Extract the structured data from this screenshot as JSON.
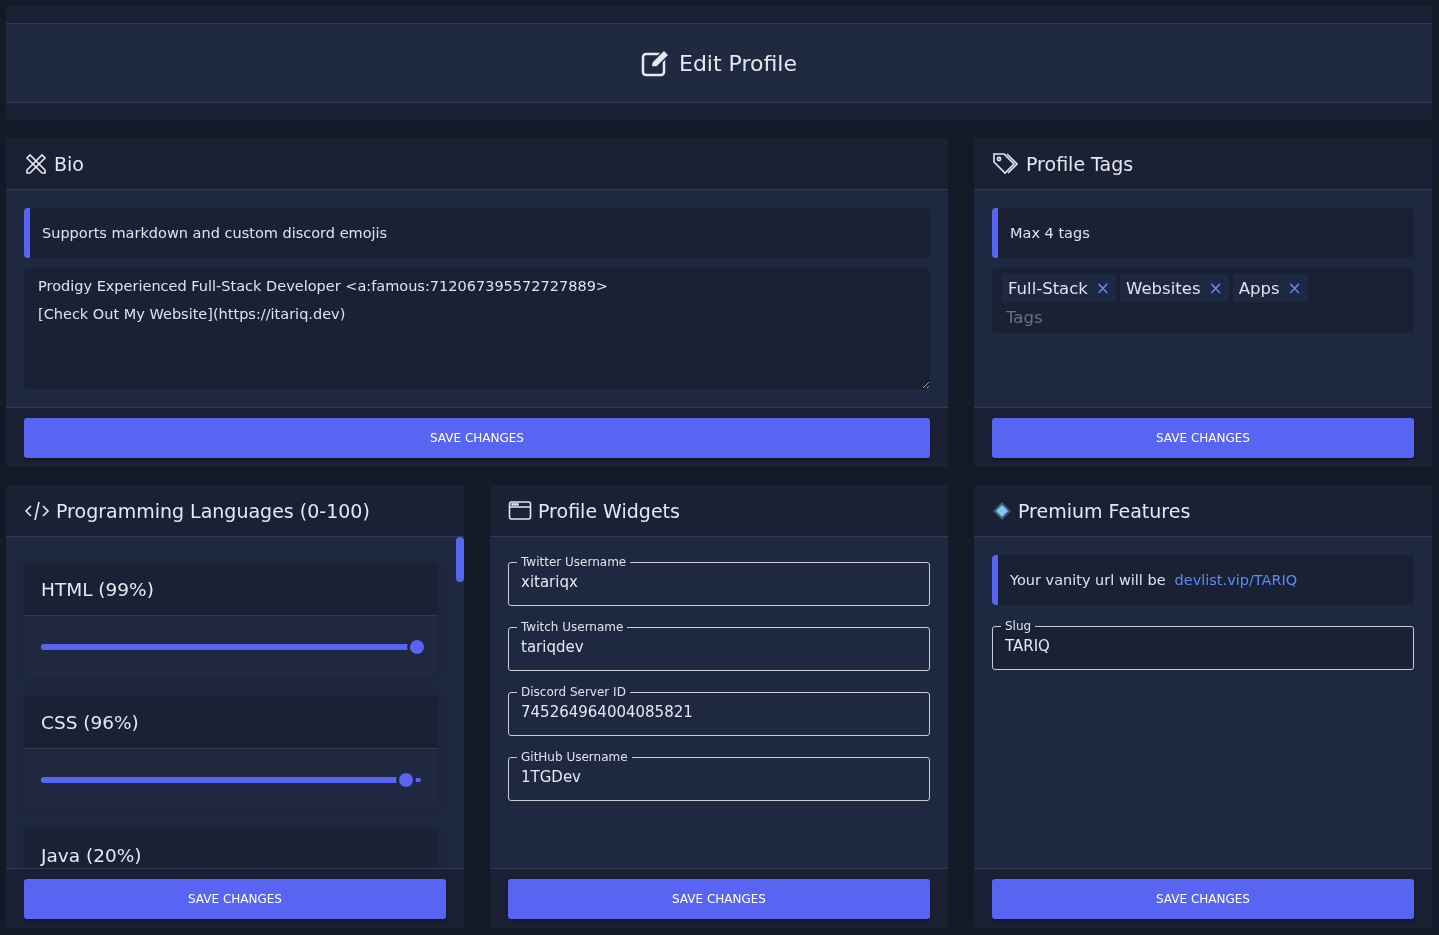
{
  "header": {
    "title": "Edit Profile"
  },
  "bio": {
    "title": "Bio",
    "note": "Supports markdown and custom discord emojis",
    "value": "Prodigy Experienced Full-Stack Developer <a:famous:712067395572727889>\n[Check Out My Website](https://itariq.dev)",
    "save_button": "SAVE CHANGES"
  },
  "profile_tags": {
    "title": "Profile Tags",
    "note": "Max 4 tags",
    "tags": [
      {
        "label": "Full-Stack",
        "remove": "×"
      },
      {
        "label": "Websites",
        "remove": "×"
      },
      {
        "label": "Apps",
        "remove": "×"
      }
    ],
    "placeholder": "Tags",
    "save_button": "SAVE CHANGES"
  },
  "programming_languages": {
    "title": "Programming Languages (0-100)",
    "languages": [
      {
        "label": "HTML (99%)",
        "level": 0.99
      },
      {
        "label": "CSS (96%)",
        "level": 0.96
      },
      {
        "label": "Java (20%)"
      }
    ],
    "save_button": "SAVE CHANGES"
  },
  "profile_widgets": {
    "title": "Profile Widgets",
    "fields": [
      {
        "label": "Twitter Username",
        "value": "xitariqx"
      },
      {
        "label": "Twitch Username",
        "value": "tariqdev"
      },
      {
        "label": "Discord Server ID",
        "value": "745264964004085821"
      },
      {
        "label": "GitHub Username",
        "value": "1TGDev"
      }
    ],
    "save_button": "SAVE CHANGES"
  },
  "premium_features": {
    "title": "Premium Features",
    "note": {
      "text": "Your vanity url will be",
      "link": "devlist.vip/TARIQ"
    },
    "fields": [
      {
        "label": "Slug",
        "value": "TARIQ"
      }
    ],
    "save_button": "SAVE CHANGES"
  }
}
